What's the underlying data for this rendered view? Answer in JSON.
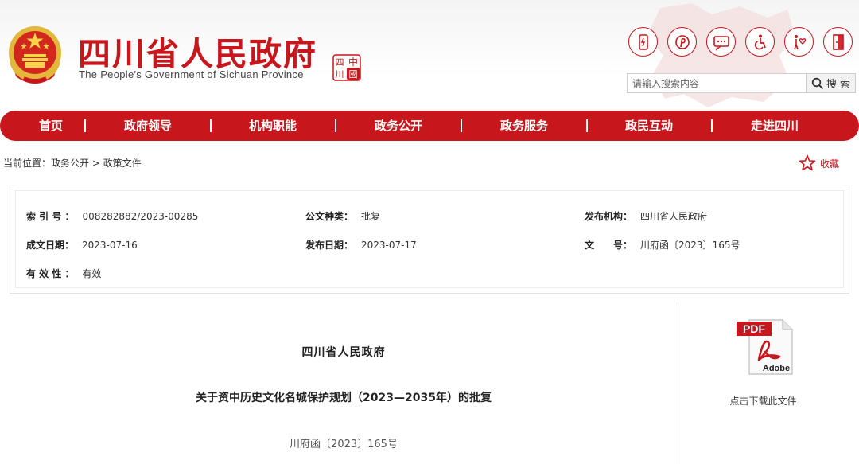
{
  "header": {
    "title": "四川省人民政府",
    "subtitle": "The People's Government of Sichuan Province",
    "seal_text": [
      "中",
      "國",
      "四",
      "川"
    ],
    "emblem_icon": "national-emblem-icon",
    "icons": [
      {
        "name": "mobile-icon"
      },
      {
        "name": "weibo-icon"
      },
      {
        "name": "message-icon"
      },
      {
        "name": "accessibility-icon"
      },
      {
        "name": "elderly-care-icon"
      },
      {
        "name": "exit-icon"
      }
    ],
    "search": {
      "placeholder": "请输入搜索内容",
      "button_label": "搜 索"
    }
  },
  "nav": {
    "items": [
      "首页",
      "政府领导",
      "机构职能",
      "政务公开",
      "政务服务",
      "政民互动",
      "走进四川"
    ]
  },
  "breadcrumb": {
    "text": "当前位置：政务公开 > 政策文件"
  },
  "favorite": {
    "label": "收藏"
  },
  "info": {
    "index_no": {
      "label": "索 引 号 ：",
      "value": "008282882/2023-00285"
    },
    "doc_type": {
      "label": "公文种类：",
      "value": "批复"
    },
    "publisher": {
      "label": "发布机构：",
      "value": "四川省人民政府"
    },
    "created_date": {
      "label": "成文日期：",
      "value": "2023-07-16"
    },
    "publish_date": {
      "label": "发布日期：",
      "value": "2023-07-17"
    },
    "doc_no": {
      "label": "文　　号：",
      "value": "川府函〔2023〕165号"
    },
    "validity": {
      "label": "有 效 性 ：",
      "value": "有效"
    }
  },
  "document": {
    "org": "四川省人民政府",
    "title": "关于资中历史文化名城保护规划（2023—2035年）的批复",
    "number": "川府函〔2023〕165号"
  },
  "download": {
    "badge": "PDF",
    "brand": "Adobe",
    "label": "点击下载此文件"
  },
  "colors": {
    "brand_red": "#c8161d"
  }
}
